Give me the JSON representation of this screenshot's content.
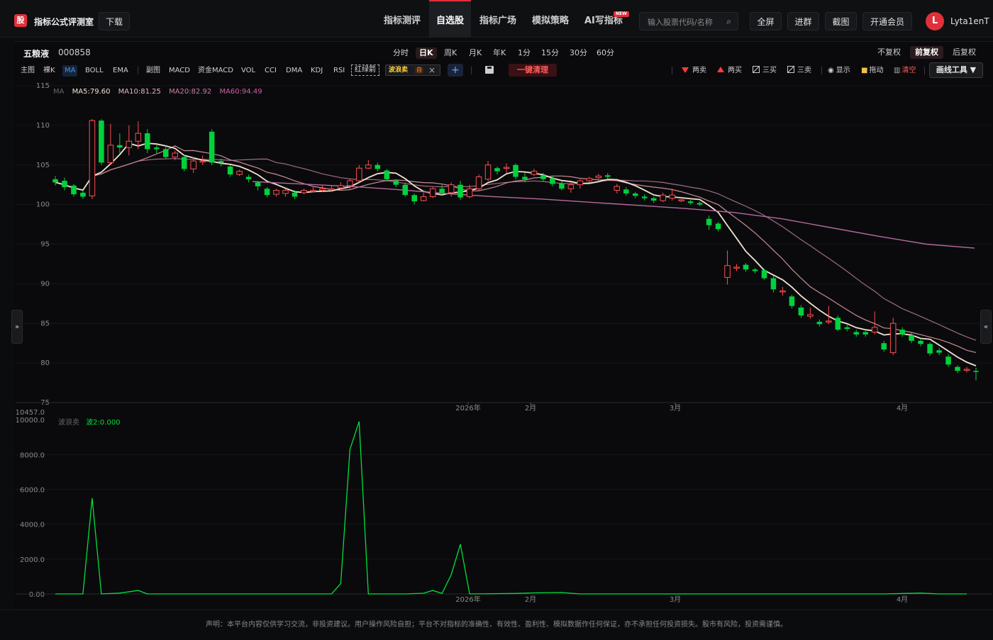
{
  "app": {
    "logo_char": "股",
    "brand": "指标公式评测室",
    "download_label": "下载"
  },
  "nav": [
    {
      "label": "指标测评",
      "active": false
    },
    {
      "label": "自选股",
      "active": true
    },
    {
      "label": "指标广场",
      "active": false
    },
    {
      "label": "模拟策略",
      "active": false
    },
    {
      "label": "AI写指标",
      "active": false
    }
  ],
  "new_badge": "NEW",
  "search": {
    "placeholder": "输入股票代码/名称"
  },
  "header_buttons": [
    "全屏",
    "进群",
    "截图",
    "开通会员"
  ],
  "user": {
    "avatar_letter": "L",
    "name": "Lyta1enT"
  },
  "stock": {
    "name": "五粮液",
    "code": "000858"
  },
  "periods": [
    {
      "label": "分时",
      "active": false
    },
    {
      "label": "日K",
      "active": true
    },
    {
      "label": "周K",
      "active": false
    },
    {
      "label": "月K",
      "active": false
    },
    {
      "label": "年K",
      "active": false
    },
    {
      "label": "1分",
      "active": false
    },
    {
      "label": "15分",
      "active": false
    },
    {
      "label": "30分",
      "active": false
    },
    {
      "label": "60分",
      "active": false
    }
  ],
  "adjust": [
    {
      "label": "不复权",
      "active": false
    },
    {
      "label": "前复权",
      "active": true
    },
    {
      "label": "后复权",
      "active": false
    }
  ],
  "main_tools": [
    "主图",
    "裸K",
    "MA",
    "BOLL",
    "EMA"
  ],
  "sub_tools": [
    "副图",
    "MACD",
    "资金MACD",
    "VOL",
    "CCI",
    "DMA",
    "KDJ",
    "RSI"
  ],
  "hl_label": "红绿箭",
  "custom_indicator": {
    "name": "波浪卖",
    "self_tag": "自"
  },
  "clear_label": "一键清理",
  "draw_tools": [
    {
      "label": "两卖",
      "icon": "triangle-down-icon"
    },
    {
      "label": "两买",
      "icon": "triangle-up-icon"
    },
    {
      "label": "三买",
      "icon": "line-draw-icon"
    },
    {
      "label": "三卖",
      "icon": "line-draw-icon"
    },
    {
      "label": "显示",
      "icon": "eye-icon"
    },
    {
      "label": "拖动",
      "icon": "lock-icon"
    },
    {
      "label": "清空",
      "icon": "trash-icon"
    }
  ],
  "draw_menu_label": "画线工具 ▼",
  "ma_legend": {
    "prefix": "MA",
    "ma5": "MA5:79.60",
    "ma10": "MA10:81.25",
    "ma20": "MA20:82.92",
    "ma60": "MA60:94.49"
  },
  "sub_legend": {
    "name": "波浪卖",
    "value": "波2:0.000"
  },
  "colors": {
    "up": "#ff4d4f",
    "down": "#00d23c",
    "ma5": "#f2e3d0",
    "ma10": "#c98c96",
    "ma20": "#9c6c84",
    "ma60": "#b66a9c",
    "wave": "#00e03c"
  },
  "chart_data": {
    "type": "candlestick",
    "price_axis": {
      "ticks": [
        115,
        110,
        105,
        100,
        95,
        90,
        85,
        80,
        75
      ],
      "range": [
        75,
        115
      ]
    },
    "x_labels": [
      "2026年",
      "2月",
      "3月",
      "4月"
    ],
    "ma60": [
      102.9,
      102.6,
      102.3,
      101.9,
      101.4,
      101.0,
      100.7,
      100.3,
      99.9,
      99.5,
      99.0,
      98.2,
      97.1,
      96.0,
      95.0,
      94.5
    ],
    "candles": [
      [
        103.2,
        102.8,
        103.6,
        102.4
      ],
      [
        103.0,
        102.2,
        103.4,
        101.8
      ],
      [
        102.4,
        101.3,
        102.6,
        101.0
      ],
      [
        101.5,
        101.0,
        101.8,
        100.7
      ],
      [
        101.1,
        110.6,
        110.8,
        100.7
      ],
      [
        110.6,
        105.3,
        110.8,
        105.0
      ],
      [
        105.3,
        107.5,
        110.2,
        105.0
      ],
      [
        107.5,
        107.2,
        109.0,
        106.5
      ],
      [
        107.2,
        108.0,
        110.0,
        106.2
      ],
      [
        108.0,
        109.0,
        110.5,
        107.0
      ],
      [
        109.0,
        107.0,
        109.5,
        106.5
      ],
      [
        107.2,
        107.0,
        107.5,
        106.5
      ],
      [
        107.0,
        106.0,
        107.3,
        105.8
      ],
      [
        106.0,
        106.5,
        106.8,
        105.6
      ],
      [
        106.0,
        104.5,
        106.3,
        104.2
      ],
      [
        104.5,
        105.5,
        106.0,
        104.0
      ],
      [
        105.5,
        105.5,
        106.2,
        105.0
      ],
      [
        109.2,
        105.3,
        109.5,
        105.0
      ],
      [
        105.5,
        105.3,
        105.8,
        104.8
      ],
      [
        104.8,
        103.8,
        105.0,
        103.5
      ],
      [
        103.8,
        104.2,
        104.4,
        103.6
      ],
      [
        103.5,
        103.2,
        103.8,
        102.8
      ],
      [
        102.8,
        102.3,
        103.0,
        101.8
      ],
      [
        102.0,
        101.2,
        102.2,
        100.9
      ],
      [
        101.3,
        101.8,
        102.0,
        101.0
      ],
      [
        101.4,
        101.8,
        102.0,
        101.0
      ],
      [
        101.5,
        101.0,
        101.8,
        100.7
      ],
      [
        101.5,
        101.8,
        102.0,
        101.3
      ],
      [
        101.8,
        101.8,
        102.2,
        101.6
      ],
      [
        101.8,
        102.0,
        102.4,
        101.6
      ],
      [
        102.0,
        102.0,
        102.4,
        101.7
      ],
      [
        102.1,
        102.4,
        102.8,
        101.9
      ],
      [
        102.4,
        103.0,
        103.3,
        102.0
      ],
      [
        103.0,
        104.6,
        105.0,
        102.8
      ],
      [
        104.6,
        105.0,
        105.6,
        104.5
      ],
      [
        105.0,
        104.5,
        105.3,
        104.2
      ],
      [
        104.3,
        103.2,
        104.5,
        102.9
      ],
      [
        103.0,
        102.5,
        103.2,
        102.2
      ],
      [
        102.5,
        101.2,
        102.8,
        101.0
      ],
      [
        101.2,
        100.4,
        101.4,
        100.0
      ],
      [
        100.5,
        101.0,
        101.5,
        100.4
      ],
      [
        101.0,
        102.0,
        102.3,
        100.8
      ],
      [
        102.0,
        101.5,
        102.5,
        101.2
      ],
      [
        101.5,
        102.5,
        102.8,
        101.0
      ],
      [
        102.5,
        100.9,
        103.0,
        100.6
      ],
      [
        101.0,
        102.0,
        102.5,
        100.8
      ],
      [
        102.0,
        103.5,
        103.8,
        101.8
      ],
      [
        103.2,
        105.0,
        105.5,
        103.0
      ],
      [
        104.6,
        104.2,
        104.8,
        103.8
      ],
      [
        104.6,
        104.7,
        105.2,
        104.0
      ],
      [
        105.0,
        103.5,
        105.2,
        103.2
      ],
      [
        103.5,
        103.2,
        104.0,
        102.8
      ],
      [
        103.8,
        104.2,
        104.5,
        103.6
      ],
      [
        103.7,
        103.2,
        104.0,
        102.9
      ],
      [
        103.3,
        102.6,
        103.6,
        102.3
      ],
      [
        102.7,
        102.0,
        103.0,
        101.8
      ],
      [
        102.0,
        102.5,
        102.8,
        101.5
      ],
      [
        102.5,
        103.0,
        103.2,
        102.0
      ],
      [
        103.0,
        103.3,
        103.5,
        102.8
      ],
      [
        103.4,
        103.6,
        103.9,
        103.2
      ],
      [
        103.7,
        103.5,
        104.0,
        103.2
      ],
      [
        101.8,
        102.3,
        102.6,
        101.4
      ],
      [
        101.9,
        101.4,
        102.2,
        101.1
      ],
      [
        101.4,
        101.1,
        101.6,
        100.8
      ],
      [
        101.0,
        100.8,
        101.3,
        100.5
      ],
      [
        100.8,
        100.5,
        101.0,
        100.2
      ],
      [
        100.5,
        101.2,
        101.5,
        100.3
      ],
      [
        100.8,
        101.2,
        102.0,
        100.5
      ],
      [
        100.5,
        100.6,
        101.0,
        100.3
      ],
      [
        100.4,
        100.2,
        100.6,
        100.0
      ],
      [
        100.2,
        100.0,
        100.4,
        99.8
      ],
      [
        98.2,
        97.4,
        98.6,
        96.8
      ],
      [
        97.6,
        96.9,
        97.8,
        96.6
      ],
      [
        90.8,
        92.3,
        94.2,
        89.9
      ],
      [
        92.1,
        92.1,
        92.5,
        91.6
      ],
      [
        92.4,
        91.8,
        92.6,
        91.5
      ],
      [
        91.8,
        91.6,
        92.0,
        91.3
      ],
      [
        91.7,
        90.7,
        91.9,
        90.5
      ],
      [
        90.7,
        89.3,
        91.0,
        88.9
      ],
      [
        89.0,
        89.1,
        89.6,
        88.5
      ],
      [
        88.4,
        87.2,
        88.6,
        86.9
      ],
      [
        87.0,
        86.0,
        87.3,
        85.7
      ],
      [
        85.9,
        86.1,
        87.0,
        85.6
      ],
      [
        85.2,
        84.9,
        85.5,
        84.6
      ],
      [
        85.2,
        85.3,
        87.2,
        84.9
      ],
      [
        85.7,
        84.2,
        86.0,
        84.0
      ],
      [
        84.5,
        84.3,
        84.8,
        84.0
      ],
      [
        83.9,
        83.6,
        84.2,
        83.3
      ],
      [
        83.9,
        83.6,
        84.2,
        83.3
      ],
      [
        83.9,
        84.5,
        86.5,
        83.6
      ],
      [
        82.5,
        81.7,
        82.8,
        81.4
      ],
      [
        81.3,
        85.0,
        85.7,
        81.0
      ],
      [
        84.2,
        83.6,
        84.5,
        83.3
      ],
      [
        83.5,
        82.8,
        83.8,
        82.5
      ],
      [
        82.8,
        82.4,
        83.1,
        82.1
      ],
      [
        82.4,
        81.2,
        82.6,
        80.9
      ],
      [
        81.6,
        81.3,
        81.9,
        81.0
      ],
      [
        80.8,
        79.8,
        81.1,
        79.5
      ],
      [
        79.5,
        79.0,
        79.7,
        78.7
      ],
      [
        79.2,
        79.2,
        79.5,
        78.8
      ],
      [
        79.0,
        78.9,
        79.4,
        77.8
      ]
    ],
    "sub_chart": {
      "name": "波浪卖",
      "y_ticks": [
        "10457.0",
        "10000.0",
        "8000.0",
        "6000.0",
        "4000.0",
        "2000.0",
        "0.00"
      ],
      "range": [
        0,
        10457
      ],
      "points": [
        [
          0,
          0
        ],
        [
          3,
          0
        ],
        [
          4,
          5500
        ],
        [
          5,
          0
        ],
        [
          7,
          50
        ],
        [
          9,
          200
        ],
        [
          10,
          0
        ],
        [
          30,
          0
        ],
        [
          31,
          600
        ],
        [
          32,
          8300
        ],
        [
          33,
          9900
        ],
        [
          34,
          0
        ],
        [
          38,
          0
        ],
        [
          40,
          40
        ],
        [
          41,
          200
        ],
        [
          42,
          30
        ],
        [
          43,
          1100
        ],
        [
          44,
          2850
        ],
        [
          45,
          0
        ],
        [
          50,
          30
        ],
        [
          52,
          60
        ],
        [
          55,
          80
        ],
        [
          57,
          0
        ],
        [
          70,
          0
        ],
        [
          80,
          0
        ],
        [
          90,
          0
        ],
        [
          94,
          50
        ],
        [
          96,
          0
        ],
        [
          99,
          0
        ]
      ]
    }
  },
  "footer": "声明：本平台内容仅供学习交流，非投资建议。用户操作风险自担；平台不对指标的准确性、有效性、盈利性、模拟数据作任何保证，亦不承担任何投资损失。股市有风险，投资需谨慎。"
}
